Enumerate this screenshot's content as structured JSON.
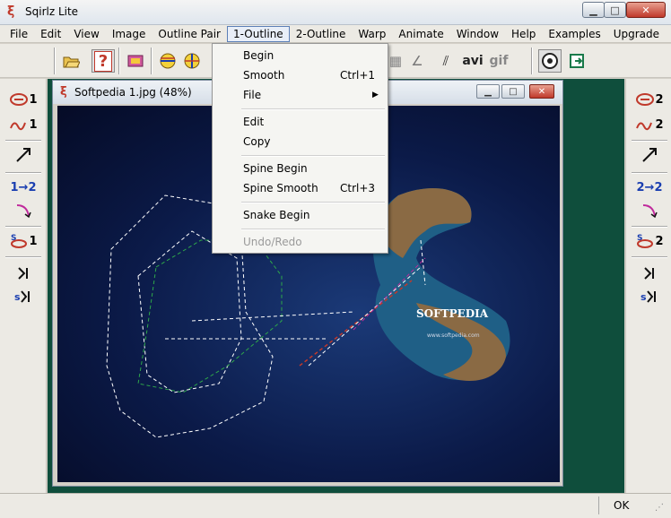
{
  "window": {
    "title": "Sqirlz Lite"
  },
  "menubar": [
    "File",
    "Edit",
    "View",
    "Image",
    "Outline Pair",
    "1-Outline",
    "2-Outline",
    "Warp",
    "Animate",
    "Window",
    "Help",
    "Examples",
    "Upgrade"
  ],
  "toolbar": {
    "avi_label": "avi",
    "gif_label": "gif"
  },
  "left_toolbar": {
    "labels": [
      "1",
      "1",
      "1→2",
      "1"
    ]
  },
  "right_toolbar": {
    "labels": [
      "2",
      "2",
      "2→2",
      "2"
    ]
  },
  "child_window": {
    "title": "Softpedia 1.jpg  (48%)"
  },
  "image": {
    "watermark": "SOFTPEDIA",
    "url_text": "www.softpedia.com"
  },
  "dropdown": {
    "items": [
      {
        "label": "Begin",
        "shortcut": "",
        "has_submenu": false,
        "disabled": false
      },
      {
        "label": "Smooth",
        "shortcut": "Ctrl+1",
        "has_submenu": false,
        "disabled": false
      },
      {
        "label": "File",
        "shortcut": "",
        "has_submenu": true,
        "disabled": false
      },
      {
        "label": "Edit",
        "shortcut": "",
        "has_submenu": false,
        "disabled": false
      },
      {
        "label": "Copy",
        "shortcut": "",
        "has_submenu": false,
        "disabled": false
      },
      {
        "label": "Spine Begin",
        "shortcut": "",
        "has_submenu": false,
        "disabled": false
      },
      {
        "label": "Spine Smooth",
        "shortcut": "Ctrl+3",
        "has_submenu": false,
        "disabled": false
      },
      {
        "label": "Snake Begin",
        "shortcut": "",
        "has_submenu": false,
        "disabled": false
      },
      {
        "label": "Undo/Redo",
        "shortcut": "",
        "has_submenu": false,
        "disabled": true
      }
    ]
  },
  "status": {
    "text": "OK"
  }
}
